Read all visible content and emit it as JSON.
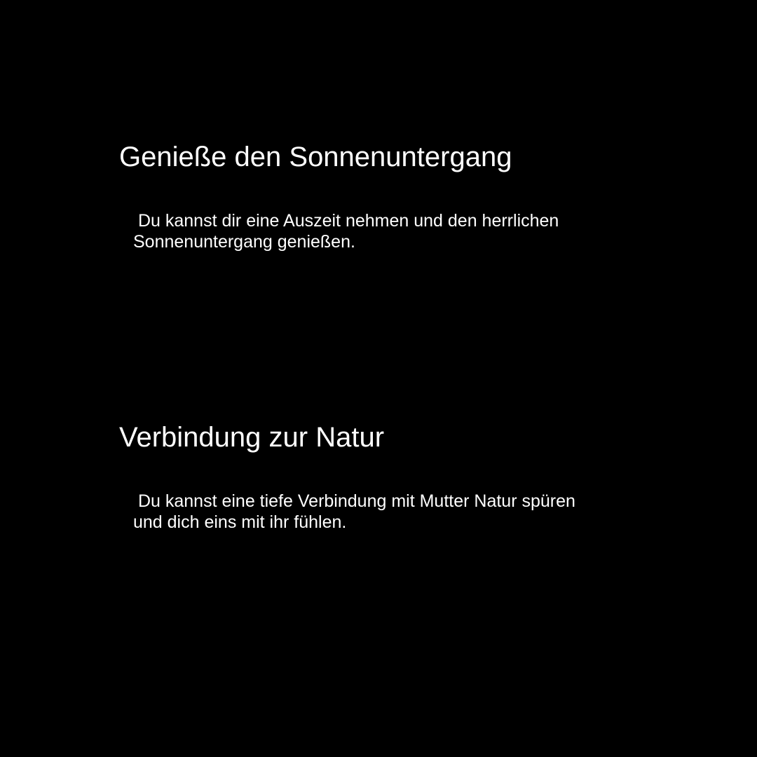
{
  "sections": [
    {
      "title": "Genieße den Sonnenuntergang",
      "text": " Du kannst dir eine Auszeit nehmen und den herrlichen Sonnenuntergang genießen."
    },
    {
      "title": "Verbindung zur Natur",
      "text": " Du kannst eine tiefe Verbindung mit Mutter Natur spüren und dich eins mit ihr fühlen."
    }
  ],
  "colors": {
    "background": "#000000",
    "text": "#ffffff"
  }
}
